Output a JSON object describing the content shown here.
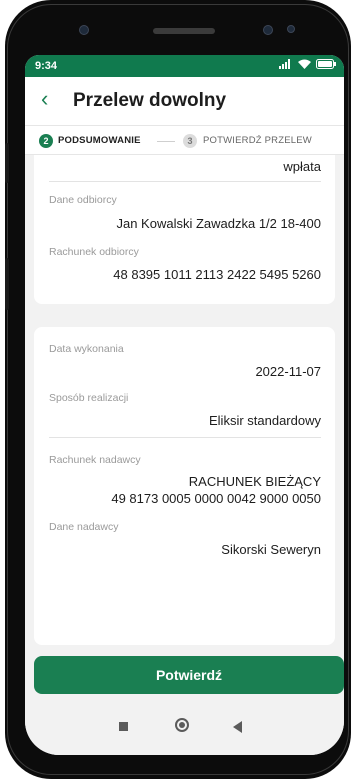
{
  "statusbar": {
    "time": "9:34"
  },
  "header": {
    "title": "Przelew dowolny"
  },
  "steps": [
    {
      "number": "2",
      "label": "PODSUMOWANIE"
    },
    {
      "number": "3",
      "label": "POTWIERDŹ PRZELEW"
    }
  ],
  "transfer_card": {
    "partial_value": "wpłata",
    "recipient_label": "Dane odbiorcy",
    "recipient_value": "Jan Kowalski Zawadzka 1/2 18-400",
    "recipient_account_label": "Rachunek odbiorcy",
    "recipient_account_value": "48 8395 1011 2113 2422 5495 5260"
  },
  "details_card": {
    "date_label": "Data wykonania",
    "date_value": "2022-11-07",
    "method_label": "Sposób realizacji",
    "method_value": "Eliksir standardowy",
    "sender_account_label": "Rachunek nadawcy",
    "sender_account_name": "RACHUNEK BIEŻĄCY",
    "sender_account_number": "49 8173 0005 0000 0042 9000 0050",
    "sender_label": "Dane nadawcy",
    "sender_value": "Sikorski Seweryn"
  },
  "confirm_button": {
    "label": "Potwierdź"
  },
  "colors": {
    "accent": "#1a7f52",
    "statusbar": "#107a4e",
    "background": "#f2f2f2"
  }
}
